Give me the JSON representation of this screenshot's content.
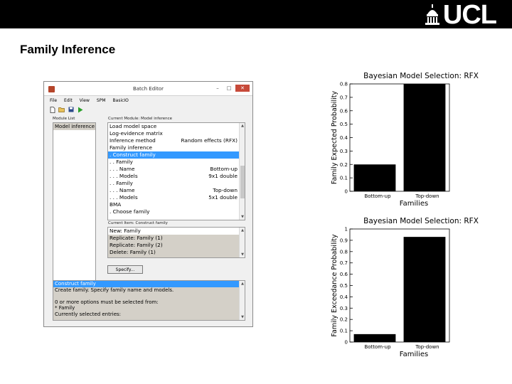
{
  "header": {
    "logo_text": "UCL"
  },
  "slide": {
    "title": "Family Inference"
  },
  "batch_editor": {
    "window_title": "Batch Editor",
    "menu": [
      "File",
      "Edit",
      "View",
      "SPM",
      "BasicIO"
    ],
    "module_list_label": "Module List",
    "module_list": [
      "Model inference"
    ],
    "current_module_label": "Current Module: Model inference",
    "module_rows": [
      {
        "label": "Load model space",
        "value": ""
      },
      {
        "label": "Log-evidence matrix",
        "value": ""
      },
      {
        "label": "Inference method",
        "value": "Random effects (RFX)"
      },
      {
        "label": "Family inference",
        "value": ""
      },
      {
        "label": ". Construct family",
        "value": ""
      },
      {
        "label": ". . Family",
        "value": ""
      },
      {
        "label": ". . . Name",
        "value": "Bottom-up"
      },
      {
        "label": ". . . Models",
        "value": "9x1 double"
      },
      {
        "label": ". . Family",
        "value": ""
      },
      {
        "label": ". . . Name",
        "value": "Top-down"
      },
      {
        "label": ". . . Models",
        "value": "5x1 double"
      },
      {
        "label": "BMA",
        "value": ""
      },
      {
        "label": ". Choose family",
        "value": ""
      }
    ],
    "current_item_label": "Current Item: Construct family",
    "item_rows": [
      "New: Family",
      "Replicate: Family (1)",
      "Replicate: Family (2)",
      "Delete: Family (1)"
    ],
    "specify_label": "Specify...",
    "help_rows": [
      "Construct family",
      "Create family. Specify family name and models.",
      "",
      "0 or more options must be selected from:",
      "* Family",
      "Currently selected entries:"
    ]
  },
  "chart_data": [
    {
      "type": "bar",
      "title": "Bayesian Model Selection: RFX",
      "xlabel": "Families",
      "ylabel": "Family Expected Probability",
      "categories": [
        "Bottom-up",
        "Top-down"
      ],
      "values": [
        0.2,
        0.8
      ],
      "ylim": [
        0,
        0.8
      ],
      "yticks": [
        "0",
        "0.1",
        "0.2",
        "0.3",
        "0.4",
        "0.5",
        "0.6",
        "0.7",
        "0.8"
      ],
      "bar_color": "#000000"
    },
    {
      "type": "bar",
      "title": "Bayesian Model Selection: RFX",
      "xlabel": "Families",
      "ylabel": "Family Exceedance Probability",
      "categories": [
        "Bottom-up",
        "Top-down"
      ],
      "values": [
        0.07,
        0.93
      ],
      "ylim": [
        0,
        1
      ],
      "yticks": [
        "0",
        "0.1",
        "0.2",
        "0.3",
        "0.4",
        "0.5",
        "0.6",
        "0.7",
        "0.8",
        "0.9",
        "1"
      ],
      "bar_color": "#000000"
    }
  ]
}
